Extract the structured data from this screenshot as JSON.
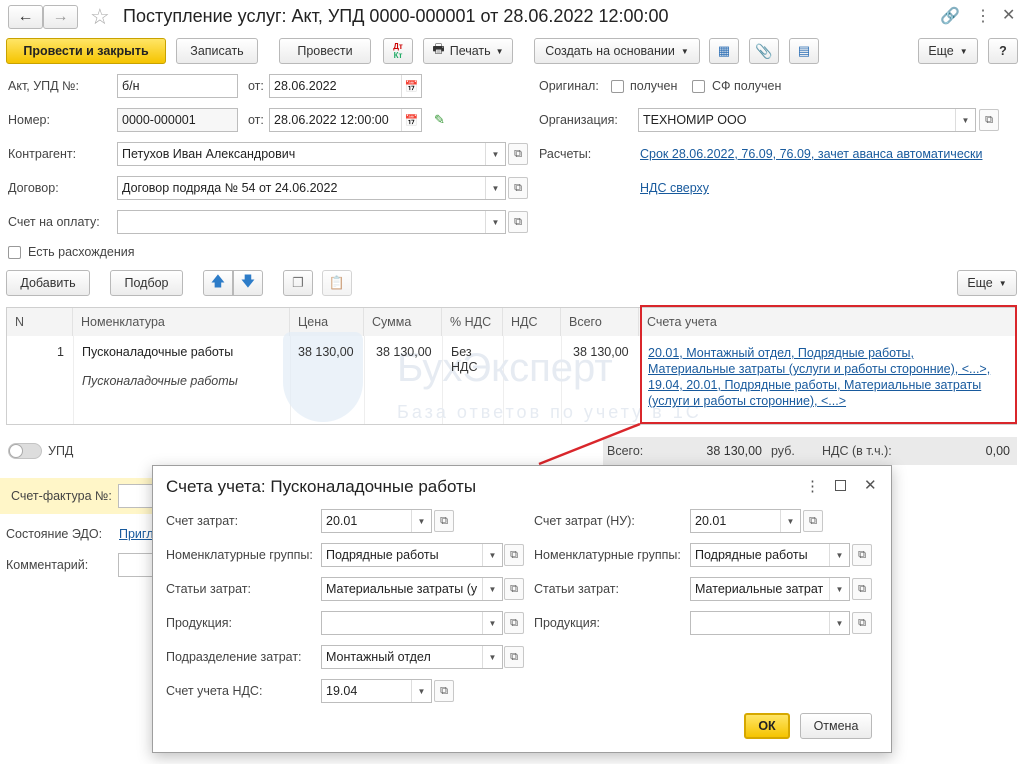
{
  "window": {
    "title": "Поступление услуг: Акт, УПД 0000-000001 от 28.06.2022 12:00:00"
  },
  "toolbar": {
    "post_close": "Провести и закрыть",
    "save": "Записать",
    "post": "Провести",
    "dt_kt_top": "Дт",
    "dt_kt_bottom": "Кт",
    "print": "Печать",
    "create_based": "Создать на основании",
    "more": "Еще",
    "help": "?"
  },
  "header": {
    "act_label": "Акт, УПД №:",
    "act_value": "б/н",
    "from_label": "от:",
    "act_date": "28.06.2022",
    "number_label": "Номер:",
    "number_value": "0000-000001",
    "number_date": "28.06.2022 12:00:00",
    "original_label": "Оригинал:",
    "received_label": "получен",
    "sf_received_label": "СФ получен",
    "org_label": "Организация:",
    "org_value": "ТЕХНОМИР ООО",
    "counterparty_label": "Контрагент:",
    "counterparty_value": "Петухов Иван Александрович",
    "settlements_label": "Расчеты:",
    "settlements_link": "Срок 28.06.2022, 76.09, 76.09, зачет аванса автоматически",
    "contract_label": "Договор:",
    "contract_value": "Договор подряда № 54 от 24.06.2022",
    "vat_link": "НДС сверху",
    "invoice_label": "Счет на оплату:",
    "invoice_value": "",
    "discrepancy_label": "Есть расхождения"
  },
  "table_toolbar": {
    "add": "Добавить",
    "pick": "Подбор",
    "more": "Еще"
  },
  "table": {
    "columns": [
      "N",
      "Номенклатура",
      "Цена",
      "Сумма",
      "% НДС",
      "НДС",
      "Всего",
      "Счета учета"
    ],
    "row": {
      "n": "1",
      "name": "Пусконаладочные работы",
      "content": "Пусконаладочные работы",
      "price": "38 130,00",
      "sum": "38 130,00",
      "vat_rate_line1": "Без",
      "vat_rate_line2": "НДС",
      "total": "38 130,00",
      "accounts_lines": [
        "20.01, Монтажный отдел, Подрядные работы,",
        "Материальные затраты (услуги и работы сторонние), <...>,",
        "19.04, 20.01, Подрядные работы, Материальные затраты",
        "(услуги и работы сторонние), <...>"
      ]
    }
  },
  "watermark": {
    "brand": "БухЭксперт",
    "tagline": "База ответов по учету в 1С"
  },
  "footer": {
    "upd_label": "УПД",
    "total_label": "Всего:",
    "total_value": "38 130,00",
    "currency": "руб.",
    "vat_label": "НДС (в т.ч.):",
    "vat_value": "0,00",
    "invoice_label": "Счет-фактура №:",
    "edo_label": "Состояние ЭДО:",
    "edo_link": "Пригл",
    "comment_label": "Комментарий:"
  },
  "dialog": {
    "title": "Счета учета: Пусконаладочные работы",
    "cost_account_label": "Счет затрат:",
    "cost_account_value": "20.01",
    "nom_groups_label": "Номенклатурные группы:",
    "nom_groups_value": "Подрядные работы",
    "cost_items_label": "Статьи затрат:",
    "cost_items_value": "Материальные затраты (у",
    "products_label": "Продукция:",
    "products_value": "",
    "division_label": "Подразделение затрат:",
    "division_value": "Монтажный отдел",
    "vat_account_label": "Счет учета НДС:",
    "vat_account_value": "19.04",
    "cost_account_nu_label": "Счет затрат (НУ):",
    "cost_account_nu_value": "20.01",
    "nom_groups_nu_label": "Номенклатурные группы:",
    "nom_groups_nu_value": "Подрядные работы",
    "cost_items_nu_label": "Статьи затрат:",
    "cost_items_nu_value": "Материальные затрат",
    "products_nu_label": "Продукция:",
    "products_nu_value": "",
    "ok": "ОК",
    "cancel": "Отмена"
  },
  "colors": {
    "accent_yellow": "#f5c400",
    "link_blue": "#185a9d",
    "highlight_red": "#d9262b"
  }
}
